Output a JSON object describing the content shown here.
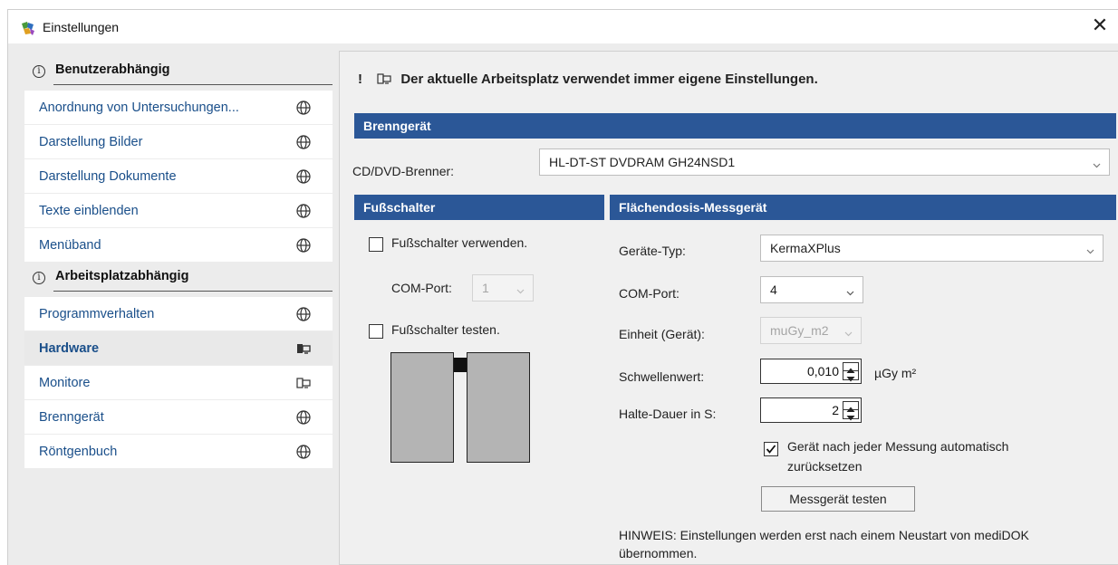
{
  "window": {
    "title": "Einstellungen",
    "close_glyph": "✕",
    "app_icon": "puzzle-icon"
  },
  "nav": {
    "groups": [
      {
        "label": "Benutzerabhängig",
        "info_glyph": "i",
        "items": [
          {
            "label": "Anordnung von Untersuchungen...",
            "icon": "globe-icon"
          },
          {
            "label": "Darstellung Bilder",
            "icon": "globe-icon"
          },
          {
            "label": "Darstellung Dokumente",
            "icon": "globe-icon"
          },
          {
            "label": "Texte einblenden",
            "icon": "globe-icon"
          },
          {
            "label": "Menüband",
            "icon": "globe-icon"
          }
        ]
      },
      {
        "label": "Arbeitsplatzabhängig",
        "info_glyph": "i",
        "items": [
          {
            "label": "Programmverhalten",
            "icon": "globe-icon"
          },
          {
            "label": "Hardware",
            "icon": "workstation-icon",
            "selected": true
          },
          {
            "label": "Monitore",
            "icon": "workstation-icon"
          },
          {
            "label": "Brenngerät",
            "icon": "globe-icon"
          },
          {
            "label": "Röntgenbuch",
            "icon": "globe-icon"
          }
        ]
      }
    ]
  },
  "panel": {
    "notice_bang": "!",
    "notice": "Der aktuelle Arbeitsplatz verwendet immer eigene Einstellungen.",
    "burner": {
      "header": "Brenngerät",
      "label": "CD/DVD-Brenner:",
      "value": "HL-DT-ST DVDRAM GH24NSD1"
    },
    "footswitch": {
      "header": "Fußschalter",
      "use_label": "Fußschalter verwenden.",
      "use_checked": false,
      "port_label": "COM-Port:",
      "port_value": "1",
      "test_label": "Fußschalter testen.",
      "test_checked": false
    },
    "dose": {
      "header": "Flächendosis-Messgerät",
      "type_label": "Geräte-Typ:",
      "type_value": "KermaXPlus",
      "port_label": "COM-Port:",
      "port_value": "4",
      "unit_label": "Einheit (Gerät):",
      "unit_value": "muGy_m2",
      "threshold_label": "Schwellenwert:",
      "threshold_value": "0,010",
      "threshold_unit": "µGy m²",
      "hold_label": "Halte-Dauer in S:",
      "hold_value": "2",
      "reset_label_line1": "Gerät nach jeder Messung automatisch",
      "reset_label_line2": "zurücksetzen",
      "reset_checked": true,
      "test_button": "Messgerät testen",
      "hint_line1": "HINWEIS: Einstellungen werden erst nach einem Neustart von mediDOK",
      "hint_line2": "übernommen."
    }
  }
}
